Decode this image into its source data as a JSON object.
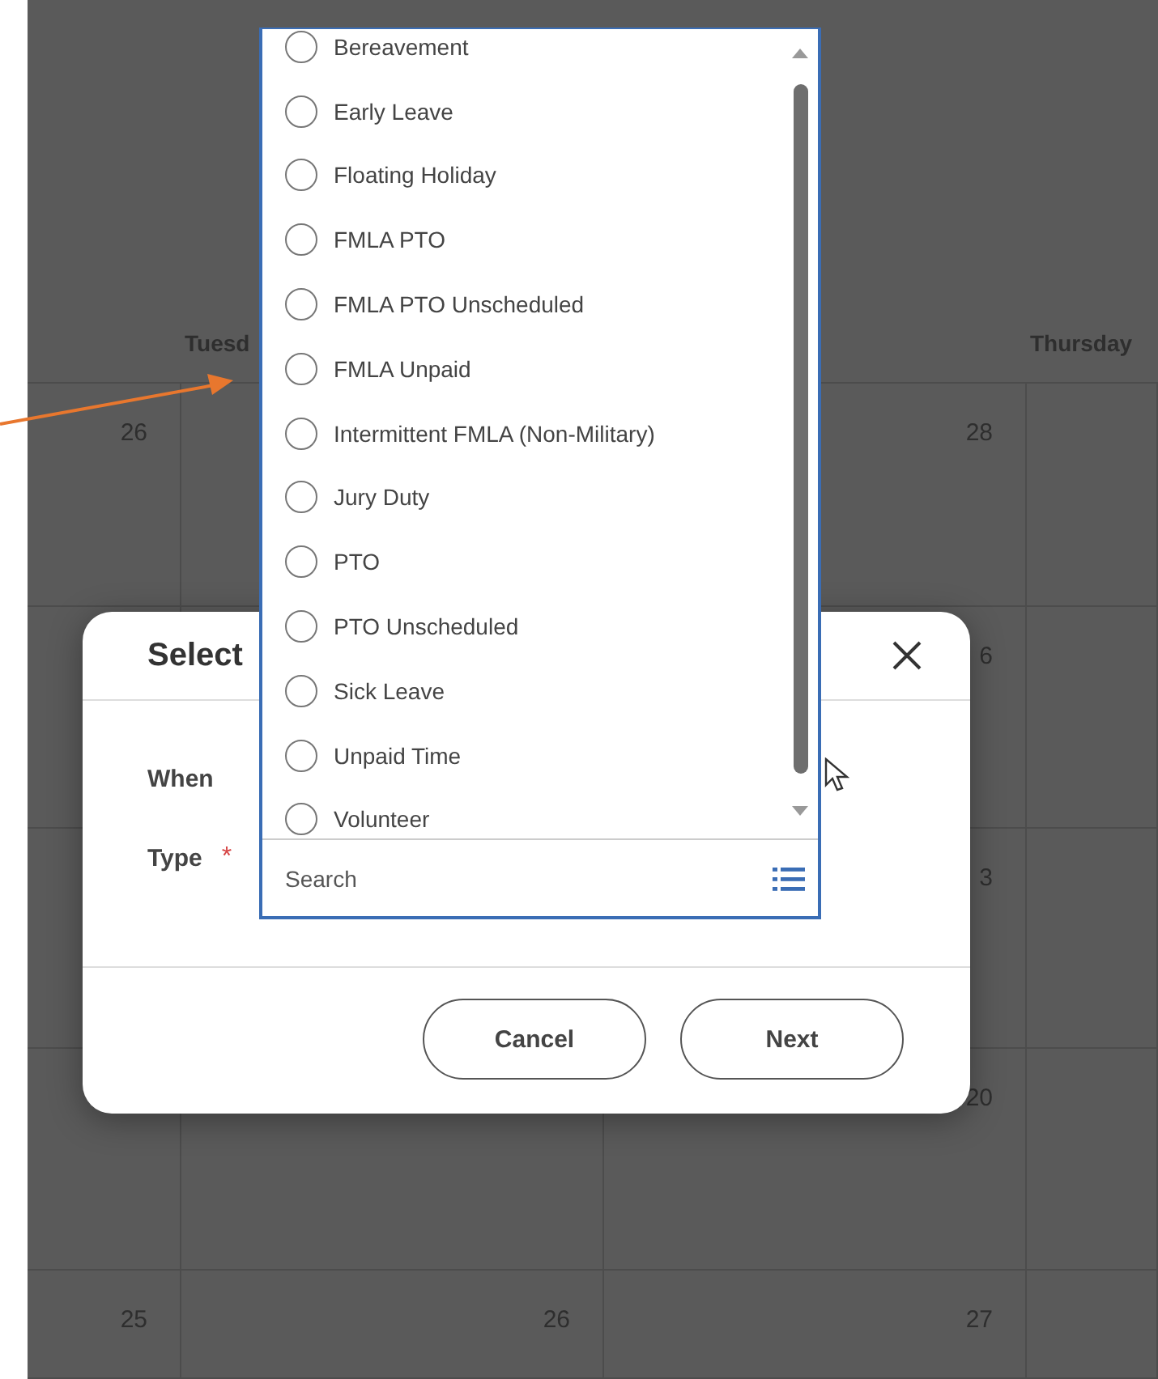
{
  "calendar": {
    "day_headers": [
      "Tuesd",
      "Thursday"
    ],
    "weeks": [
      {
        "col_1": "26",
        "col_3": "28"
      },
      {
        "col_3": "6"
      },
      {
        "col_3": "3"
      },
      {
        "col_3": "20"
      },
      {
        "col_1": "25",
        "col_2": "26",
        "col_3": "27"
      }
    ]
  },
  "dialog": {
    "title": "Select",
    "fields": [
      {
        "label": "When"
      },
      {
        "label": "Type",
        "required_mark": "*"
      }
    ],
    "buttons": [
      "Cancel",
      "Next"
    ]
  },
  "dropdown": {
    "options": [
      {
        "label": "Bereavement",
        "selected": false
      },
      {
        "label": "Early Leave",
        "selected": false
      },
      {
        "label": "Floating Holiday",
        "selected": false
      },
      {
        "label": "FMLA PTO",
        "selected": false
      },
      {
        "label": "FMLA PTO Unscheduled",
        "selected": false
      },
      {
        "label": "FMLA Unpaid",
        "selected": false
      },
      {
        "label": "Intermittent FMLA (Non-Military)",
        "selected": false
      },
      {
        "label": "Jury Duty",
        "selected": false
      },
      {
        "label": "PTO",
        "selected": false
      },
      {
        "label": "PTO Unscheduled",
        "selected": false
      },
      {
        "label": "Sick Leave",
        "selected": false
      },
      {
        "label": "Unpaid Time",
        "selected": false
      },
      {
        "label": "Volunteer",
        "selected": false
      }
    ],
    "search": {
      "placeholder": "Search"
    }
  }
}
